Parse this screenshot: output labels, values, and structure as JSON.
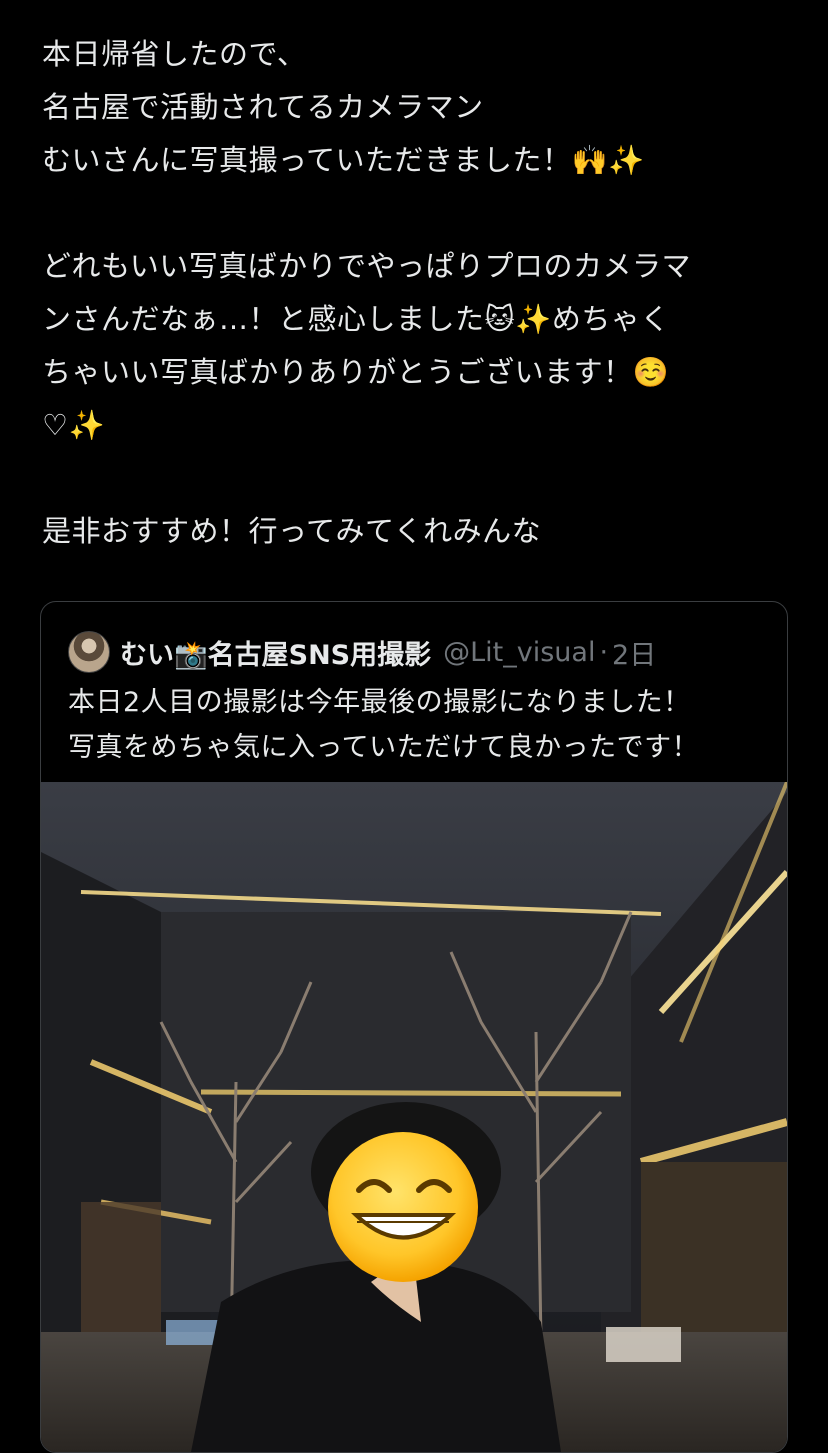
{
  "tweet": {
    "lines": [
      "本日帰省したので、",
      "名古屋で活動されてるカメラマン",
      "むいさんに写真撮っていただきました！🙌✨",
      "",
      "どれもいい写真ばかりでやっぱりプロのカメラマ",
      "ンさんだなぁ…！と感心しました🐱✨めちゃく",
      "ちゃいい写真ばかりありがとうございます！☺️",
      "♡✨",
      "",
      "是非おすすめ！行ってみてくれみんな"
    ]
  },
  "quote": {
    "name": "むい📸名古屋SNS用撮影",
    "handle": "@Lit_visual",
    "separator": "·",
    "time": "2日",
    "lines": [
      "本日2人目の撮影は今年最後の撮影になりました！",
      "写真をめちゃ気に入っていただけて良かったです！"
    ],
    "photo_overlay_emoji": "😁"
  },
  "colors": {
    "background": "#000000",
    "text": "#e7e9ea",
    "secondary": "#71767b",
    "border": "#3a3d40"
  }
}
